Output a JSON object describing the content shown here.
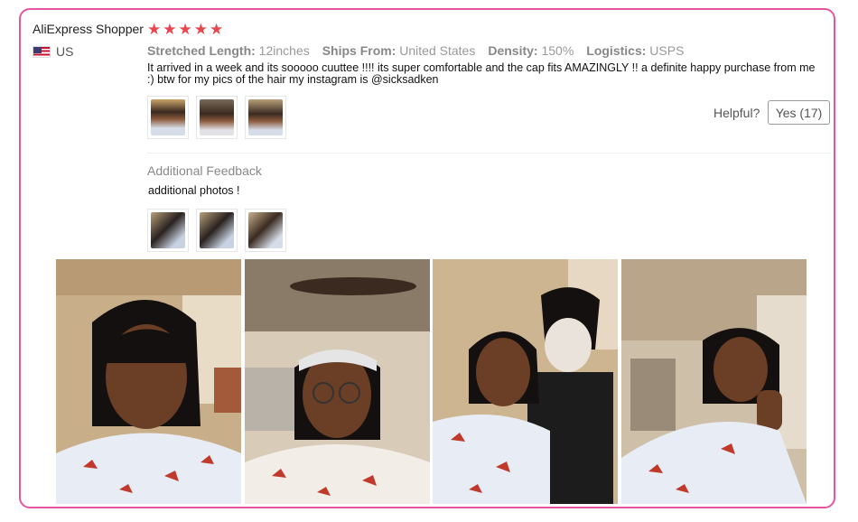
{
  "review": {
    "reviewer": "AliExpress Shopper",
    "rating_stars": 5,
    "country": "US",
    "flag_icon": "us-flag-icon",
    "attributes": [
      {
        "key": "Stretched Length:",
        "value": "12inches"
      },
      {
        "key": "Ships From:",
        "value": "United States"
      },
      {
        "key": "Density:",
        "value": "150%"
      },
      {
        "key": "Logistics:",
        "value": "USPS"
      }
    ],
    "text": "It arrived in a week and its sooooo cuuttee !!!! its super comfortable and the cap fits AMAZINGLY !! a definite happy purchase from me :) btw for my pics of the hair my instagram is @sicksadken",
    "helpful_label": "Helpful?",
    "yes_button": "Yes (17)"
  },
  "additional": {
    "title": "Additional Feedback",
    "text": "additional photos !"
  },
  "colors": {
    "card_border": "#e5569f",
    "star": "#e8454c",
    "text_muted": "#999999"
  }
}
